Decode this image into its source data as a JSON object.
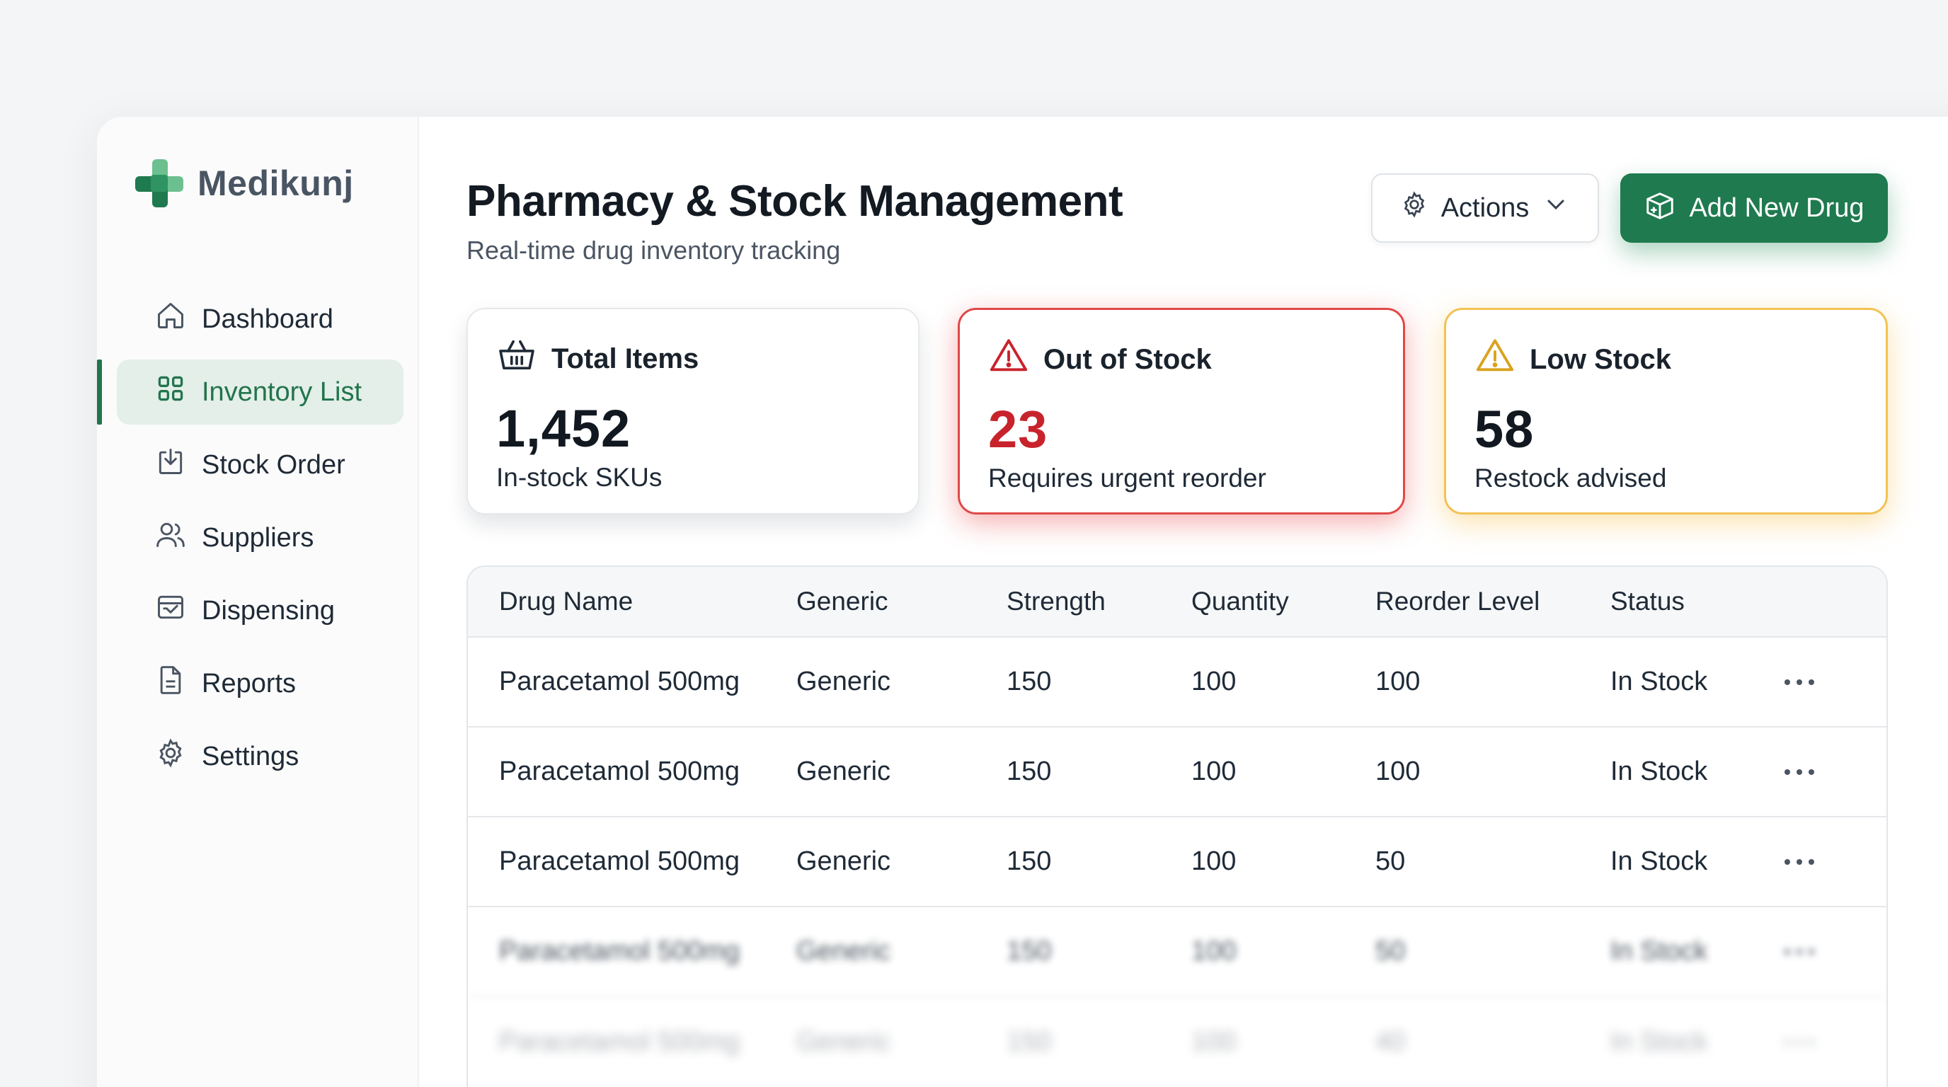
{
  "brand": {
    "name": "Medikunj",
    "logo_icon": "medical-cross-icon",
    "color_primary": "#1f7a4f",
    "color_secondary": "#6cc08f"
  },
  "sidebar": {
    "items": [
      {
        "label": "Dashboard",
        "icon": "home-icon",
        "active": false
      },
      {
        "label": "Inventory List",
        "icon": "grid-icon",
        "active": true
      },
      {
        "label": "Stock Order",
        "icon": "download-box-icon",
        "active": false
      },
      {
        "label": "Suppliers",
        "icon": "users-icon",
        "active": false
      },
      {
        "label": "Dispensing",
        "icon": "dispense-icon",
        "active": false
      },
      {
        "label": "Reports",
        "icon": "document-icon",
        "active": false
      },
      {
        "label": "Settings",
        "icon": "gear-icon",
        "active": false
      }
    ]
  },
  "header": {
    "title": "Pharmacy & Stock Management",
    "subtitle": "Real-time drug inventory tracking",
    "actions_label": "Actions",
    "add_label": "Add New Drug"
  },
  "cards": {
    "total": {
      "title": "Total Items",
      "value": "1,452",
      "note": "In-stock SKUs",
      "icon": "basket-icon",
      "accent": "#e6e8eb"
    },
    "out": {
      "title": "Out of Stock",
      "value": "23",
      "note": "Requires urgent reorder",
      "icon": "warning-icon",
      "accent": "#e04848"
    },
    "low": {
      "title": "Low Stock",
      "value": "58",
      "note": "Restock advised",
      "icon": "warning-icon",
      "accent": "#f2c255"
    }
  },
  "table": {
    "headers": [
      "Drug Name",
      "Generic",
      "Strength",
      "Quantity",
      "Reorder Level",
      "Status"
    ],
    "rows": [
      [
        "Paracetamol 500mg",
        "Generic",
        "150",
        "100",
        "100",
        "In Stock"
      ],
      [
        "Paracetamol 500mg",
        "Generic",
        "150",
        "100",
        "100",
        "In Stock"
      ],
      [
        "Paracetamol 500mg",
        "Generic",
        "150",
        "100",
        "50",
        "In Stock"
      ],
      [
        "Paracetamol 500mg",
        "Generic",
        "150",
        "100",
        "50",
        "In Stock"
      ],
      [
        "Paracetamol 500mg",
        "Generic",
        "150",
        "100",
        "40",
        "In Stock"
      ]
    ]
  }
}
